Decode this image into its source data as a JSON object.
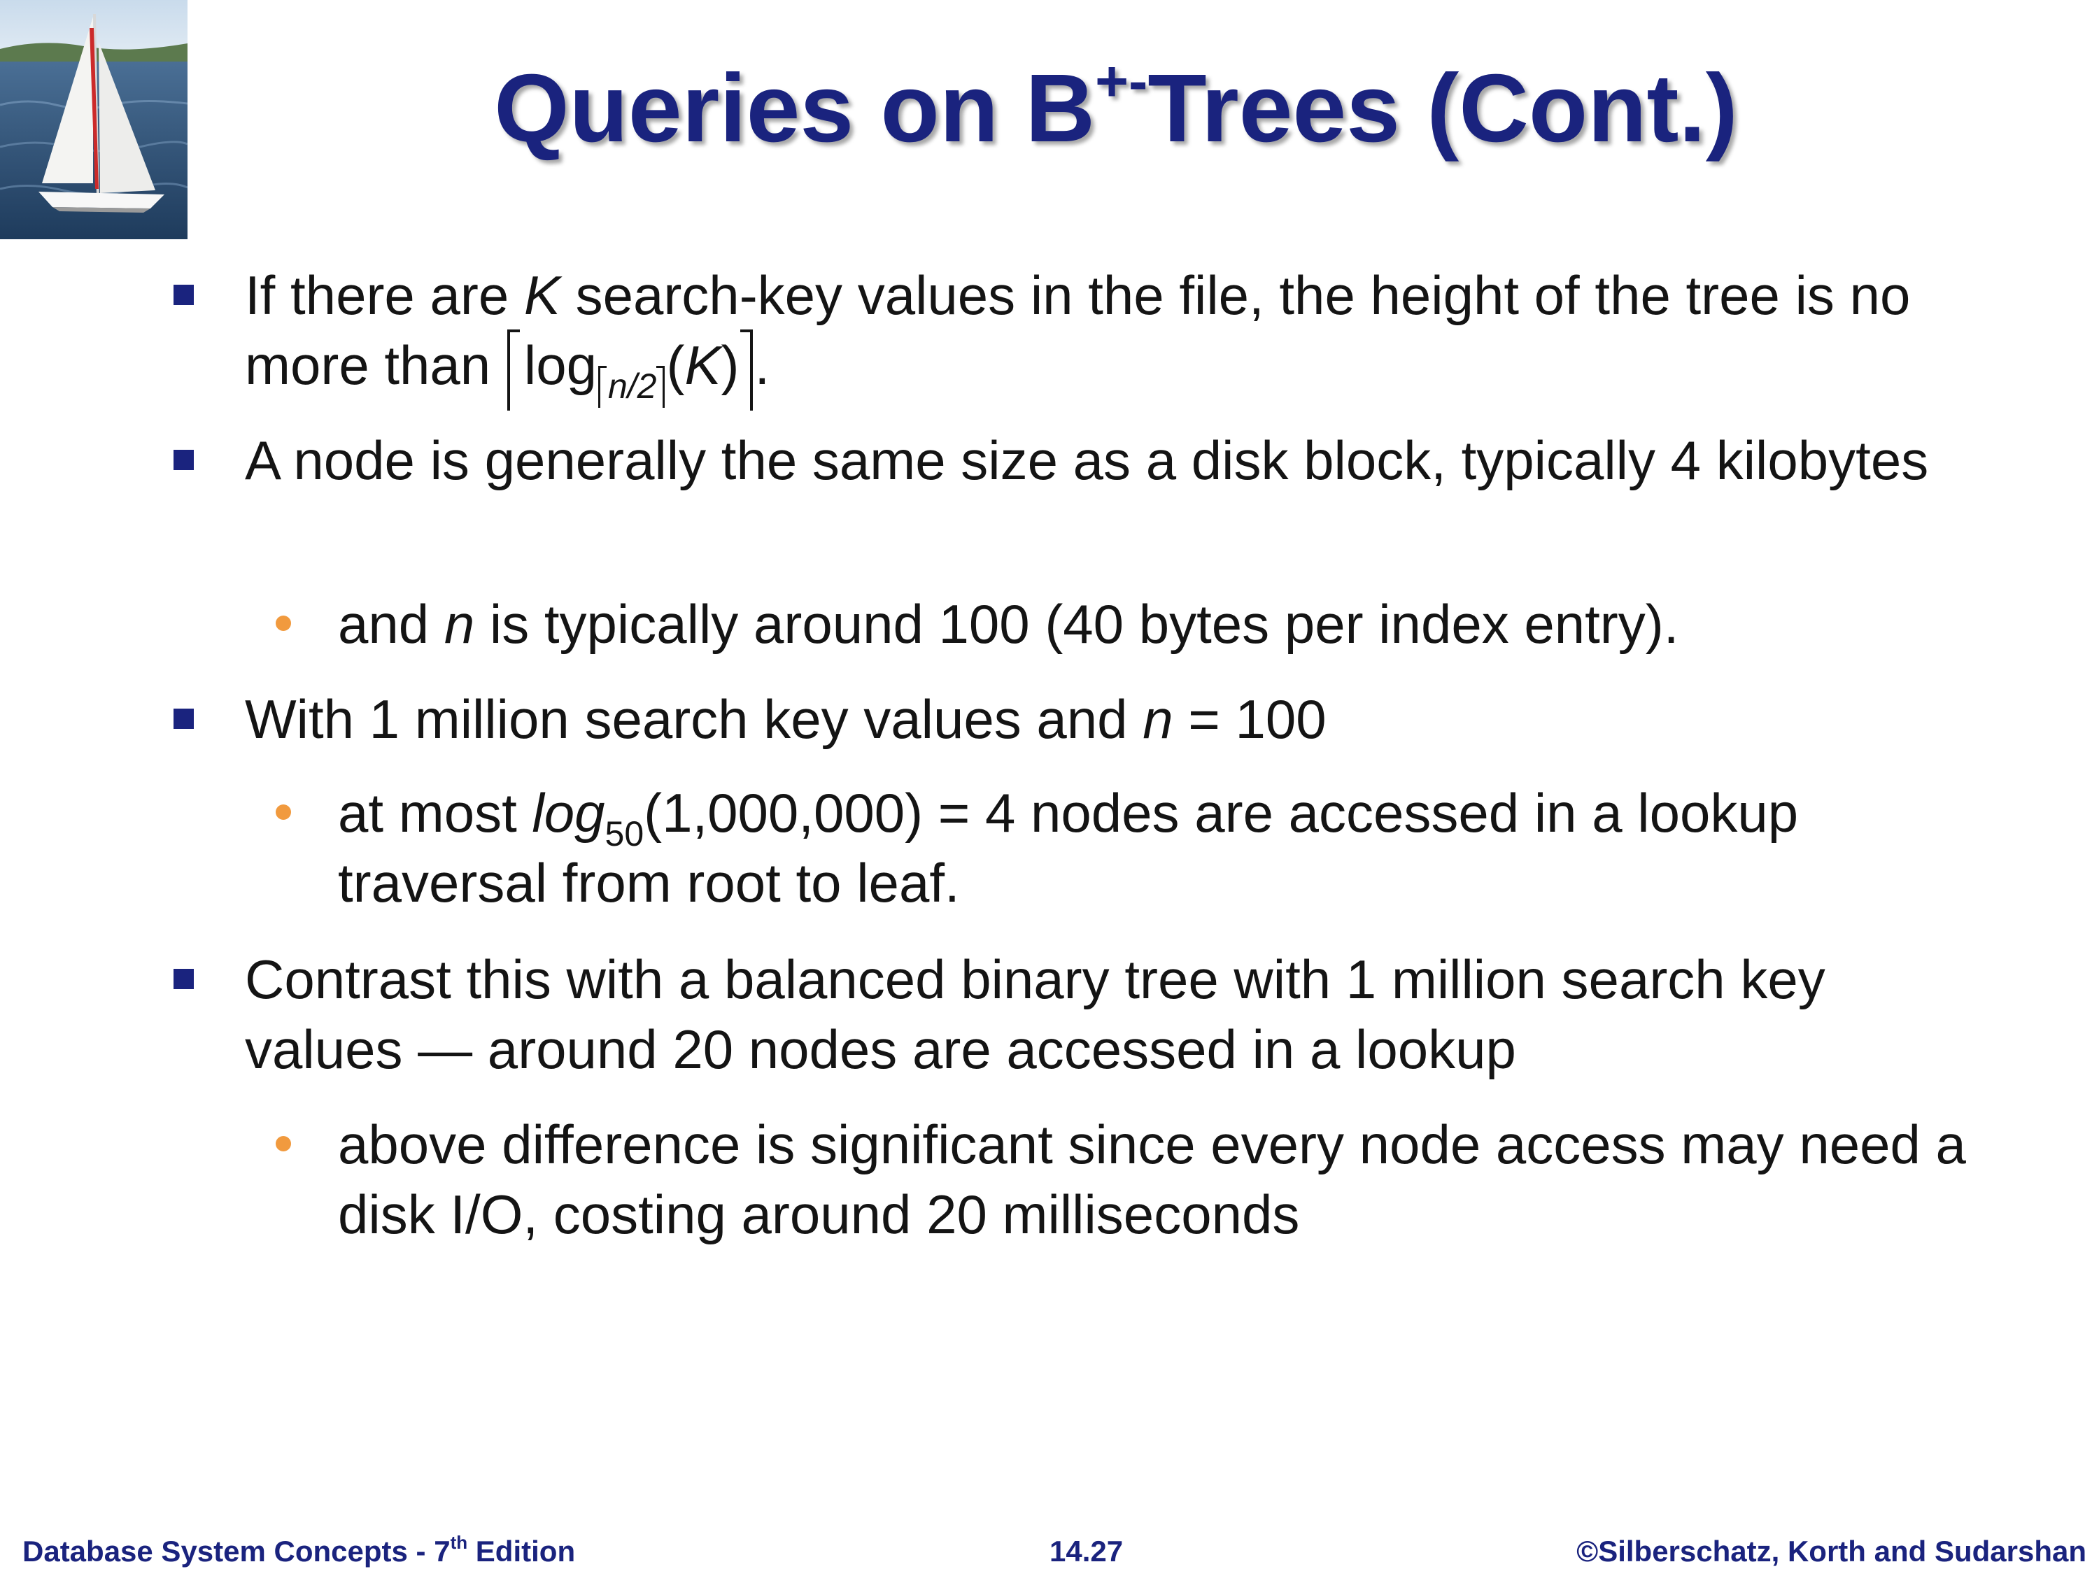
{
  "title": {
    "prefix": "Queries on B",
    "superscript": "+-",
    "suffix": "Trees (Cont.)"
  },
  "bullets": [
    {
      "level": 1,
      "parts": {
        "a": "If there are ",
        "k": "K",
        "b": " search-key values in the file, the height of the tree is no more than ",
        "log": "log",
        "n2": "n/2",
        "paren_open": "(",
        "k2": "K",
        "paren_close": ")",
        "end": "."
      }
    },
    {
      "level": 1,
      "text": "A node is generally the same size as a disk block, typically 4 kilobytes"
    },
    {
      "level": 2,
      "parts": {
        "a": "and ",
        "n": "n",
        "b": " is typically around 100 (40 bytes per index entry)."
      }
    },
    {
      "level": 1,
      "parts": {
        "a": "With 1 million search key values and ",
        "n": "n",
        "b": " = 100"
      }
    },
    {
      "level": 2,
      "parts": {
        "a": "at most  ",
        "log": "log",
        "base": "50",
        "b": "(1,000,000) = 4 nodes are accessed in a lookup traversal from root to leaf."
      }
    },
    {
      "level": 1,
      "text": "Contrast this with a balanced binary tree with 1 million search key values — around 20 nodes are accessed in a lookup"
    },
    {
      "level": 2,
      "text": "above difference is significant since every node access may need a disk I/O, costing around 20 milliseconds"
    }
  ],
  "footer": {
    "left_prefix": "Database System Concepts - 7",
    "left_sup": "th",
    "left_suffix": " Edition",
    "center": "14.27",
    "right": "©Silberschatz, Korth and Sudarshan"
  },
  "colors": {
    "title": "#1a237e",
    "bullet_square": "#1a237e",
    "bullet_dot": "#f19a3e",
    "body_text": "#141414"
  },
  "icons": {
    "logo": "sailboat-image"
  }
}
